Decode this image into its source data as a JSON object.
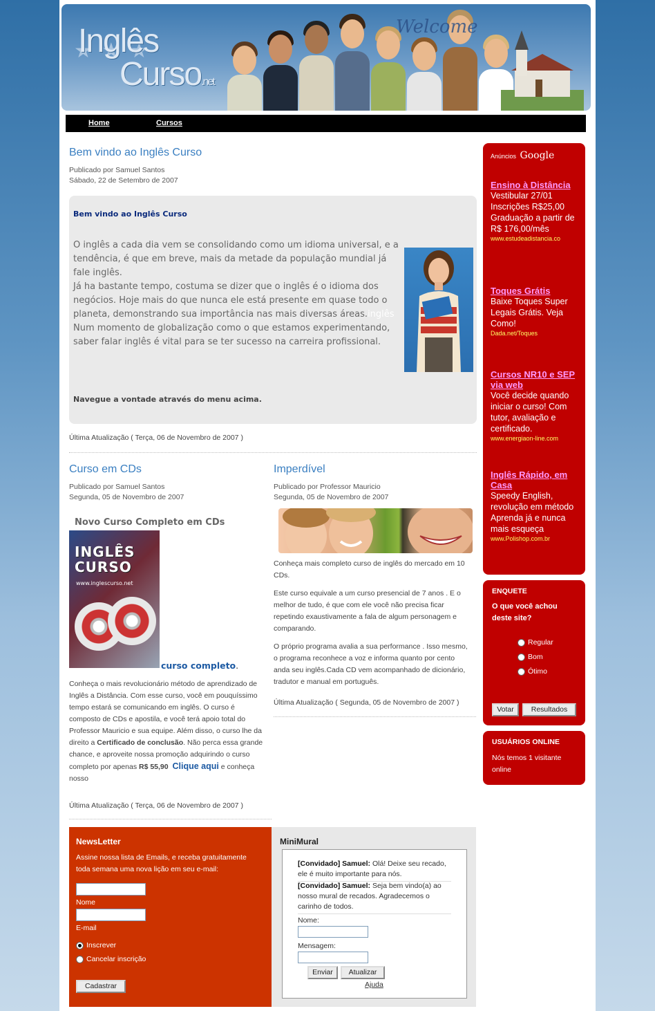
{
  "header": {
    "logo_line1": "Inglês",
    "logo_line2": "Curso",
    "logo_suffix": ".net",
    "welcome_text": "Welcome"
  },
  "nav": {
    "items": [
      {
        "label": "Home"
      },
      {
        "label": "Cursos"
      }
    ]
  },
  "welcome_article": {
    "title": "Bem vindo ao Inglês Curso",
    "author": "Publicado por Samuel Santos",
    "date": "Sábado, 22 de Setembro de 2007",
    "box_heading": "Bem vindo ao Inglês Curso",
    "para1": "O inglês a cada dia vem se consolidando como um idioma universal,  e a tendência, é que em breve,  mais da metade da população mundial já fale inglês.",
    "para2": "Já ha bastante tempo, costuma se dizer que o inglês é o idioma dos negócios. Hoje mais do que nunca ele está presente em quase todo o planeta, demonstrando sua importância nas mais diversas áreas.",
    "para2_link": "inglês",
    "para3": "Num momento de globalização como o que estamos experimentando, saber falar inglês é vital para se ter sucesso na carreira profissional.",
    "nav_hint": "Navegue a vontade através do menu acima.",
    "updated": "Última Atualização ( Terça, 06 de Novembro de 2007 )"
  },
  "cd_article": {
    "title": "Curso em CDs",
    "author": "Publicado por Samuel Santos",
    "date": "Segunda, 05 de Novembro de 2007",
    "subheading": "Novo Curso Completo em CDs",
    "image_logo1": "INGLÊS",
    "image_logo2": "CURSO",
    "image_url": "www.inglescurso.net",
    "link_label": "curso completo",
    "link_suffix": ".",
    "body_part1": "Conheça o mais revolucionário método de aprendizado de Inglês a Distância. Com esse curso, você em pouquíssimo tempo estará se comunicando em inglês.  O curso é composto de CDs e apostila, e você terá apoio total do Professor Mauricio e sua equipe. Além disso, o curso lhe da direito a",
    "body_bold": "Certificado de conclusão",
    "body_part2": ". Não perca essa grande chance, e aproveite nossa  promoção adquirindo o curso completo por apenas",
    "price": "R$ 55,90",
    "cta": "Clique aqui",
    "body_end": "e conheça nosso",
    "updated": "Última Atualização ( Terça, 06 de Novembro de 2007 )"
  },
  "imperdivel_article": {
    "title": "Imperdível",
    "author": "Publicado por Professor Mauricio",
    "date": "Segunda, 05 de Novembro de 2007",
    "p1": "Conheça mais completo curso de inglês do mercado em 10 CDs.",
    "p2": "Este curso equivale a um curso presencial de 7 anos . E o melhor de tudo, é que com ele você não precisa ficar repetindo exaustivamente a fala de algum personagem e comparando.",
    "p3": "O próprio programa avalia a sua performance . Isso mesmo, o programa reconhece a voz e informa quanto por cento anda seu inglês.Cada CD vem acompanhado de dicionário, tradutor e manual em português.",
    "updated": "Última Atualização ( Segunda, 05 de Novembro de 2007 )"
  },
  "ads": {
    "header_prefix": "Anúncios",
    "header_brand": "Google",
    "items": [
      {
        "title": "Ensino à Distância",
        "body": "Vestibular 27/01 Inscrições R$25,00 Graduação a partir de R$ 176,00/mês",
        "url": "www.estudeadistancia.co"
      },
      {
        "title": "Toques Grátis",
        "body": "Baixe Toques Super Legais Grátis. Veja Como!",
        "url": "Dada.net/Toques"
      },
      {
        "title": "Cursos NR10 e SEP via web",
        "body": "Você decide quando iniciar o curso! Com tutor, avaliação e certificado.",
        "url": "www.energiaon-line.com"
      },
      {
        "title": "Inglês Rápido, em Casa",
        "body": "Speedy English, revolução em método Aprenda já e nunca mais esqueça",
        "url": "www.Polishop.com.br"
      }
    ]
  },
  "poll": {
    "title": "ENQUETE",
    "question": "O que você achou deste site?",
    "options": [
      "Regular",
      "Bom",
      "Ótimo"
    ],
    "vote_label": "Votar",
    "results_label": "Resultados"
  },
  "online": {
    "title": "USUÁRIOS ONLINE",
    "text": "Nós temos 1 visitante online"
  },
  "newsletter": {
    "title": "NewsLetter",
    "text": "Assine nossa lista de Emails, e receba gratuitamente toda semana uma nova lição em seu e-mail:",
    "name_label": "Nome",
    "email_label": "E-mail",
    "subscribe_label": "Inscrever",
    "unsubscribe_label": "Cancelar inscrição",
    "selected": "Inscrever",
    "submit_label": "Cadastrar"
  },
  "mural": {
    "title": "MiniMural",
    "messages": [
      {
        "author": "[Convidado] Samuel:",
        "text": "Olá! Deixe seu recado, ele é muito importante para nós."
      },
      {
        "author": "[Convidado] Samuel:",
        "text": "Seja bem vindo(a) ao nosso mural de recados. Agradecemos o carinho de todos."
      }
    ],
    "name_label": "Nome:",
    "message_label": "Mensagem:",
    "send_label": "Enviar",
    "refresh_label": "Atualizar",
    "help_label": "Ajuda"
  },
  "colors": {
    "accent_blue": "#3a7fc1",
    "sidebar_red": "#c00000",
    "newsletter_red": "#cc3300",
    "nav_black": "#000000"
  }
}
